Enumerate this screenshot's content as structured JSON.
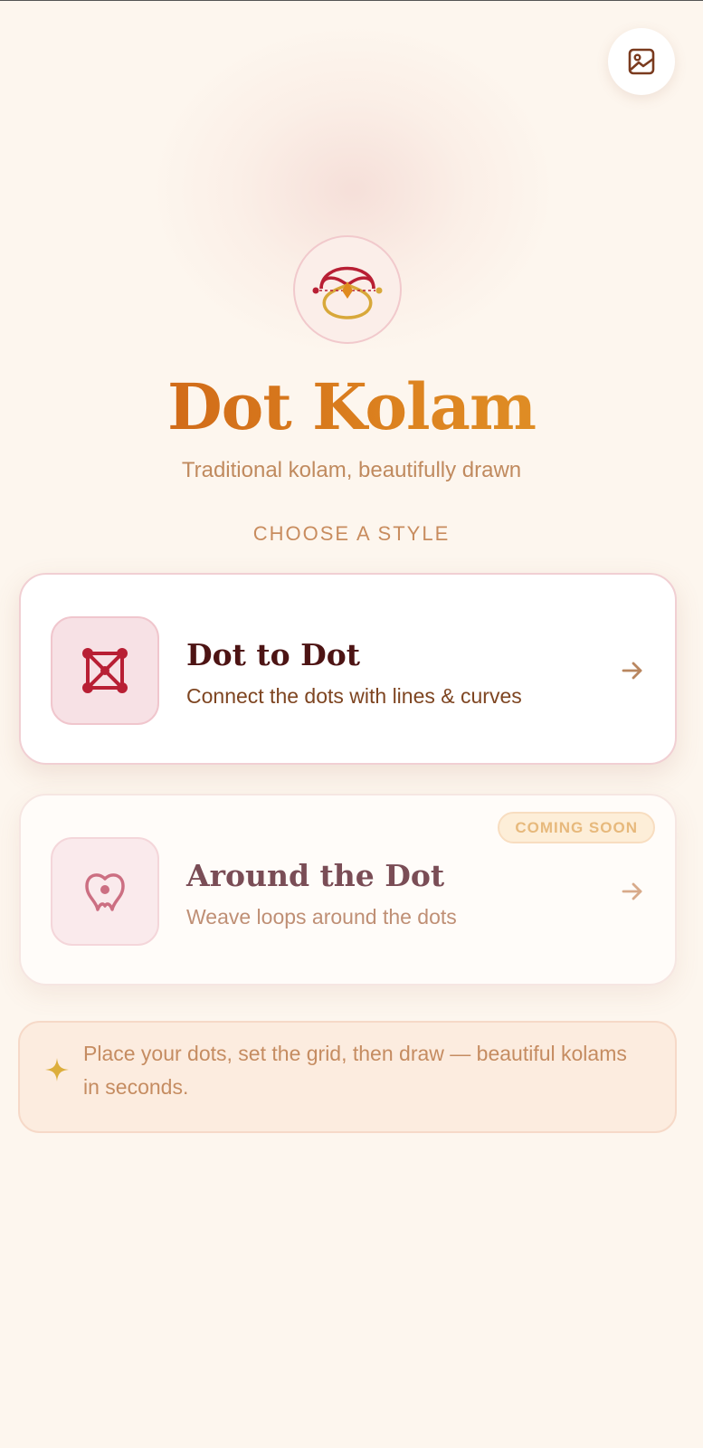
{
  "app": {
    "title": "Dot Kolam",
    "tagline": "Traditional kolam, beautifully drawn"
  },
  "header": {
    "gallery_icon": "image-icon"
  },
  "section": {
    "label": "CHOOSE A STYLE"
  },
  "styles": [
    {
      "title": "Dot to Dot",
      "description": "Connect the dots with lines & curves",
      "icon": "dot-grid-icon",
      "badge": ""
    },
    {
      "title": "Around the Dot",
      "description": "Weave loops around the dots",
      "icon": "loop-around-dot-icon",
      "badge": "COMING SOON"
    }
  ],
  "tip": {
    "icon": "sparkle-icon",
    "text": "Place your dots, set the grid, then draw — beautiful kolams in seconds."
  },
  "colors": {
    "background": "#fdf6ee",
    "accent_red": "#b81f34",
    "accent_gold": "#d8a83a",
    "title_orange": "#d86f16"
  }
}
